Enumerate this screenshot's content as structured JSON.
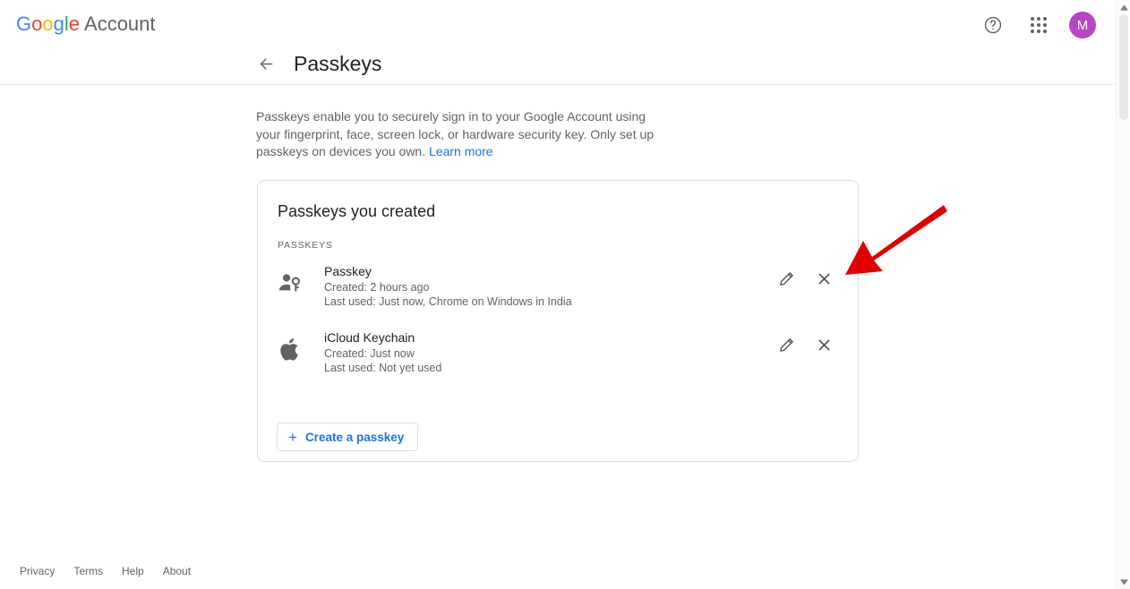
{
  "header": {
    "brand_google": "Google",
    "brand_g": "G",
    "brand_o1": "o",
    "brand_o2": "o",
    "brand_g2": "g",
    "brand_l": "l",
    "brand_e": "e",
    "brand_account": "Account",
    "help_icon": "help-circle-icon",
    "apps_icon": "apps-grid-icon",
    "avatar_letter": "M",
    "avatar_color": "#ba45c4"
  },
  "title": {
    "back_icon": "arrow-back-icon",
    "text": "Passkeys"
  },
  "description": {
    "line": "Passkeys enable you to securely sign in to your Google Account using your fingerprint, face, screen lock, or hardware security key. Only set up passkeys on devices you own.",
    "link_label": "Learn more",
    "link_color": "#1a73e8"
  },
  "card": {
    "heading": "Passkeys you created",
    "section_label": "PASSKEYS",
    "rows": [
      {
        "icon": "person-key-icon",
        "name": "Passkey",
        "created": "Created: 2 hours ago",
        "last_used": "Last used: Just now, Chrome on Windows in India",
        "edit_icon": "pencil-edit-icon",
        "remove_icon": "close-x-icon"
      },
      {
        "icon": "apple-logo-icon",
        "name": "iCloud Keychain",
        "created": "Created: Just now",
        "last_used": "Last used: Not yet used",
        "edit_icon": "pencil-edit-icon",
        "remove_icon": "close-x-icon"
      }
    ],
    "create_button": {
      "plus": "+",
      "label": "Create a passkey"
    }
  },
  "annotation": {
    "arrow_color": "#e00000",
    "points_to": "close-x-icon-row-1"
  },
  "footer": {
    "links": [
      {
        "label": "Privacy"
      },
      {
        "label": "Terms"
      },
      {
        "label": "Help"
      },
      {
        "label": "About"
      }
    ]
  }
}
